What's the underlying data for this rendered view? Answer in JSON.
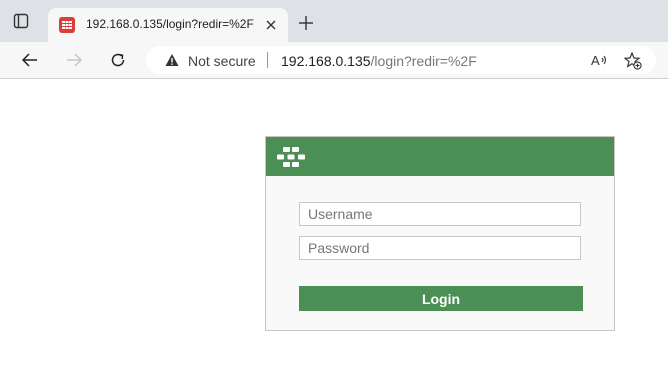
{
  "browser": {
    "tab": {
      "title": "192.168.0.135/login?redir=%2F",
      "favicon": "fortinet-logo-icon",
      "favicon_color": "#da3d3a"
    },
    "toolbar": {
      "back_icon": "back-arrow-icon",
      "forward_icon": "forward-arrow-icon",
      "refresh_icon": "refresh-icon",
      "security_icon": "warning-triangle-icon",
      "security_label": "Not secure",
      "url_host": "192.168.0.135",
      "url_path": "/login?redir=%2F",
      "read_aloud_icon": "read-aloud-icon",
      "favorites_icon": "add-favorite-icon"
    }
  },
  "login": {
    "header_color": "#4b8f54",
    "brand_icon": "fortinet-logo-icon",
    "username_placeholder": "Username",
    "password_placeholder": "Password",
    "button_label": "Login"
  }
}
